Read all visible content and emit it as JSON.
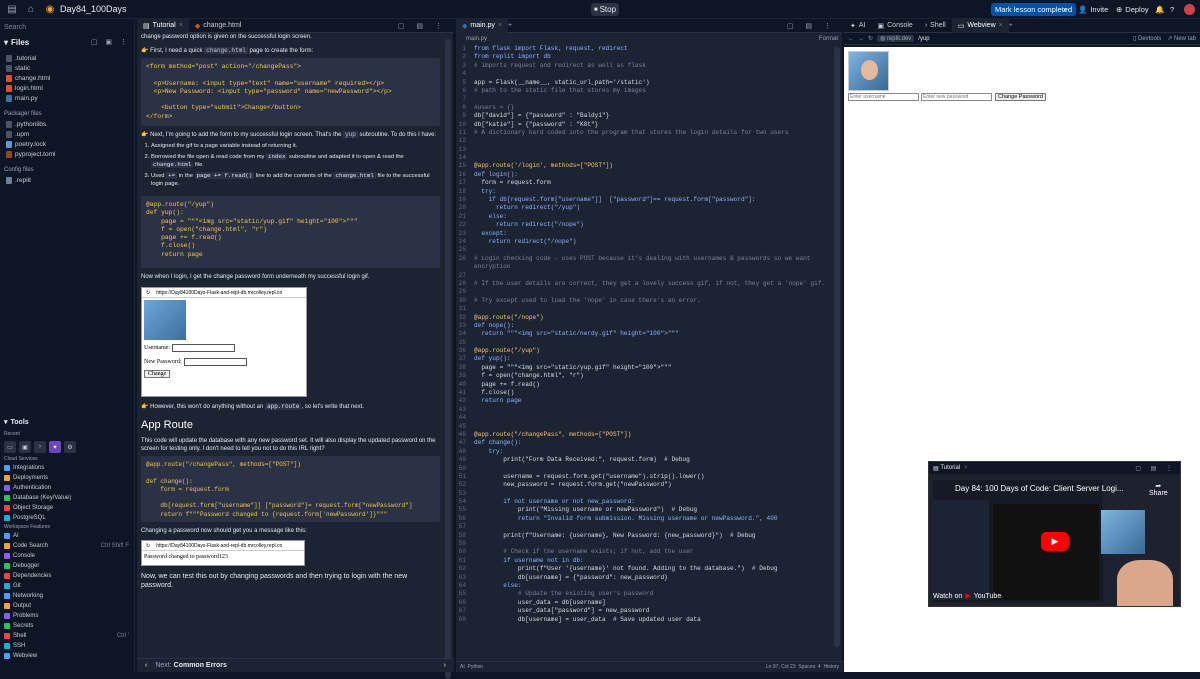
{
  "topbar": {
    "repl_name": "Day84_100Days",
    "stop_label": "Stop",
    "mark_label": "Mark lesson completed",
    "invite_label": "Invite",
    "deploy_label": "Deploy"
  },
  "files": {
    "search_label": "Search",
    "files_header": "Files",
    "items": [
      ".tutorial",
      "static",
      "change.html",
      "login.html",
      "main.py"
    ],
    "packager_header": "Packager files",
    "packager_items": [
      ".pythonlibs",
      ".upm",
      "poetry.lock",
      "pyproject.toml"
    ],
    "config_header": "Config files",
    "config_items": [
      ".replit"
    ]
  },
  "tools": {
    "header": "Tools",
    "recent_label": "Recent",
    "cloud_label": "Cloud Services",
    "cloud_items": [
      "Integrations",
      "Deployments",
      "Authentication",
      "Database (Key/Value)",
      "Object Storage",
      "PostgreSQL"
    ],
    "workspace_label": "Workspace Features",
    "workspace_items": [
      "AI",
      "Code Search",
      "Console",
      "Debugger",
      "Dependencies",
      "Git",
      "Networking",
      "Output",
      "Problems",
      "Secrets",
      "Shell",
      "SSH",
      "Webview"
    ],
    "code_search_shortcut": "Ctrl Shift F",
    "shell_shortcut": "Ctrl '"
  },
  "tutorial": {
    "tab_tutorial": "Tutorial",
    "tab_change": "change.html",
    "p0": "change password option is given on the successful login screen.",
    "p1a": "First, I need a quick ",
    "p1code": "change.html",
    "p1b": " page to create the form:",
    "code1": "<form method=\"post\" action=\"/changePass\">\n\n  <p>Username: <input type=\"text\" name=\"username\" required></p>\n  <p>New Password: <input type=\"password\" name=\"newPassword\"></p>\n\n    <button type=\"submit\">Change</button>\n</form>",
    "p2a": "Next, I'm going to add the form to my successful login screen. That's the ",
    "p2code": "yup",
    "p2b": " subroutine. To do this I have:",
    "li1": "Assigned the gif to a page variable instead of returning it.",
    "li2a": "Borrowed the file open & read code from my ",
    "li2code": "index",
    "li2b": " subroutine and adapted it to open & read the ",
    "li2code2": "change.html",
    "li2c": " file.",
    "li3a": "Used ",
    "li3code": "+=",
    "li3b": " in the ",
    "li3code2": "page += f.read()",
    "li3c": " line to add the contents of the ",
    "li3code3": "change.html",
    "li3d": " file to the successful login page.",
    "code2": "@app.route(\"/yup\")\ndef yup():\n    page = \"\"\"<img src=\"static/yup.gif\" height=\"100\">\"\"\"\n    f = open(\"change.html\", \"r\")\n    page += f.read()\n    f.close()\n    return page",
    "p3": "Now when I login, I get the change password form underneath my successful login gif.",
    "ss1_url": "https://Day84100Days-Flask-and-repl-db.mrcolley.repl.co",
    "ss1_user": "Username:",
    "ss1_pass": "New Password:",
    "ss1_btn": "Change",
    "p4a": "However, this won't do anything without an ",
    "p4code": "app.route",
    "p4b": ", so let's write that next.",
    "heading": "App Route",
    "p5": "This code will update the database with any new password set. It will also display the updated password on the screen for testing only. I don't need to tell you not to do this IRL right?",
    "code3": "@app.route(\"/changePass\", methods=[\"POST\"])\n\ndef change():\n    form = request.form\n\n    db[request.form[\"username\"]] [\"password\"]= request.form[\"newPassword\"]\n    return f\"\"\"Password changed to {request.form['newPassword']}\"\"\"",
    "p6": "Changing a password now should get you a message like this:",
    "ss2_url": "https://Day84100Days-Flask-and-repl-db.mrcolley.repl.co",
    "ss2_msg": "Password changed to password123",
    "p7": "Now, we can test this out by changing passwords and then trying to login with the new password.",
    "next_label": "Next:",
    "next_title": "Common Errors"
  },
  "editor": {
    "tab": "main.py",
    "breadcrumb": "main.py",
    "format_label": "Format",
    "status_ai": "AI",
    "status_lang": "Python",
    "status_pos": "Ln 97, Col 23",
    "status_spaces": "Spaces: 4",
    "status_history": "History",
    "lines": [
      "from flask import Flask, request, redirect",
      "from replit import db",
      "# imports request and redirect as well as flask",
      "",
      "app = Flask(__name__, static_url_path='/static')",
      "# path to the static file that stores my images",
      "",
      "#users = {}",
      "db[\"david\"] = {\"password\" : \"Baldy1\"}",
      "db[\"katie\"] = {\"password\" : \"K8t\"}",
      "# A dictionary hard coded into the program that stores the login details for two users",
      "",
      "",
      "",
      "@app.route('/login', methods=[\"POST\"])",
      "def login():",
      "  form = request.form",
      "  try:",
      "    if db[request.form[\"username\"]]  [\"password\"]== request.form[\"password\"]:",
      "      return redirect(\"/yup\")",
      "    else:",
      "      return redirect(\"/nope\")",
      "  except:",
      "    return redirect(\"/nope\")",
      "",
      "# Login checking code - uses POST because it's dealing with usernames & passwords so we want",
      "encryption",
      "",
      "# If the user details are correct, they get a lovely success gif, if not, they get a 'nope' gif.",
      "",
      "# Try except used to load the 'nope' in case there's an error.",
      "",
      "@app.route(\"/nope\")",
      "def nope():",
      "  return \"\"\"<img src=\"static/nerdy.gif\" height=\"100\">\"\"\"",
      "",
      "@app.route(\"/yup\")",
      "def yup():",
      "  page = \"\"\"<img src=\"static/yup.gif\" height=\"100\">\"\"\"",
      "  f = open(\"change.html\", \"r\")",
      "  page += f.read()",
      "  f.close()",
      "  return page",
      "",
      "",
      "",
      "@app.route(\"/changePass\", methods=[\"POST\"])",
      "def change():",
      "    try:",
      "        print(\"Form Data Received:\", request.form)  # Debug",
      "",
      "        username = request.form.get(\"username\").strip().lower()",
      "        new_password = request.form.get(\"newPassword\")",
      "",
      "        if not username or not new_password:",
      "            print(\"Missing username or newPassword\")  # Debug",
      "            return \"Invalid form submission. Missing username or newPassword.\", 400",
      "",
      "        print(f\"Username: {username}, New Password: {new_password}\")  # Debug",
      "",
      "        # Check if the username exists; if not, add the user",
      "        if username not in db:",
      "            print(f\"User '{username}' not found. Adding to the database.\")  # Debug",
      "            db[username] = {\"password\": new_password}",
      "        else:",
      "            # Update the existing user's password",
      "            user_data = db[username]",
      "            user_data[\"password\"] = new_password",
      "            db[username] = user_data  # Save updated user data"
    ],
    "line_numbers": [
      "1",
      "2",
      "3",
      "4",
      "5",
      "6",
      "7",
      "8",
      "9",
      "10",
      "11",
      "12",
      "13",
      "14",
      "15",
      "16",
      "17",
      "18",
      "19",
      "20",
      "21",
      "22",
      "23",
      "24",
      "25",
      "26",
      "",
      "27",
      "28",
      "29",
      "30",
      "31",
      "32",
      "33",
      "34",
      "35",
      "36",
      "37",
      "38",
      "39",
      "40",
      "41",
      "42",
      "43",
      "44",
      "45",
      "46",
      "47",
      "48",
      "49",
      "50",
      "51",
      "52",
      "53",
      "54",
      "55",
      "56",
      "57",
      "58",
      "59",
      "60",
      "61",
      "62",
      "63",
      "64",
      "65",
      "66",
      "67",
      "68",
      "69"
    ]
  },
  "webview": {
    "tab_ai": "AI",
    "tab_console": "Console",
    "tab_shell": "Shell",
    "tab_webview": "Webview",
    "url_host": "replit.dev",
    "url_path": "/yup",
    "devtools_label": "Devtools",
    "newtab_label": "New tab",
    "username_placeholder": "Enter username",
    "password_placeholder": "Enter new password",
    "change_btn": "Change Password"
  },
  "video": {
    "tab": "Tutorial",
    "title": "Day 84: 100 Days of Code: Client Server Logi...",
    "share_label": "Share",
    "watch_label": "Watch on",
    "youtube_label": "YouTube"
  },
  "colors": {
    "accent": "#0053a6",
    "bg": "#0e1525",
    "panel": "#1c2333"
  }
}
